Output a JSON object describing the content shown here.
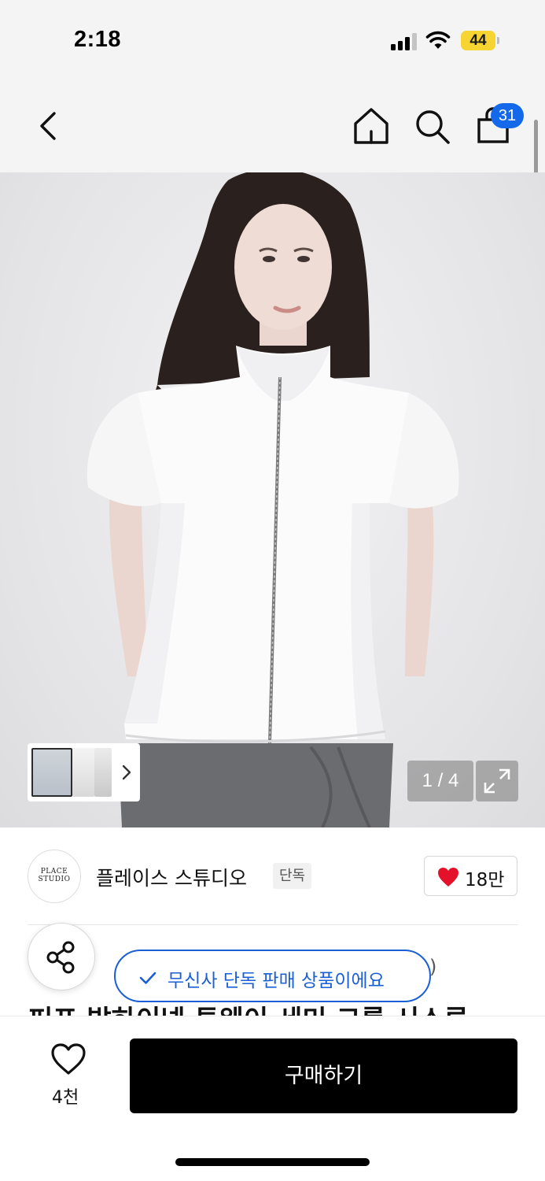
{
  "status_bar": {
    "time": "2:18",
    "battery": "44",
    "battery_color": "#f6d432"
  },
  "nav": {
    "back_icon": "chevron-left-icon",
    "home_icon": "home-icon",
    "search_icon": "search-icon",
    "cart_icon": "shopping-bag-icon",
    "cart_count": "31",
    "badge_color": "#1469ea"
  },
  "gallery": {
    "counter": "1 / 4",
    "expand_icon": "expand-icon",
    "thumb_arrow_icon": "chevron-right-icon",
    "thumbnail_count": 3,
    "current_image": 1,
    "total_images": 4
  },
  "brand": {
    "logo_text": "PLACE STUDIO",
    "name": "플레이스 스튜디오",
    "tag": "단독",
    "like_count": "18만",
    "heart_color": "#e4112b"
  },
  "product": {
    "title_partial": "퍼프 발하이넥 투웨이 세미 크롭 시스루",
    "breadcrumb_close": ")"
  },
  "share": {
    "icon": "share-icon"
  },
  "toast": {
    "text": "무신사 단독 판매 상품이에요",
    "check_icon": "check-icon",
    "color": "#1a5fd6"
  },
  "bottom_bar": {
    "wish_count": "4천",
    "buy_label": "구매하기"
  }
}
